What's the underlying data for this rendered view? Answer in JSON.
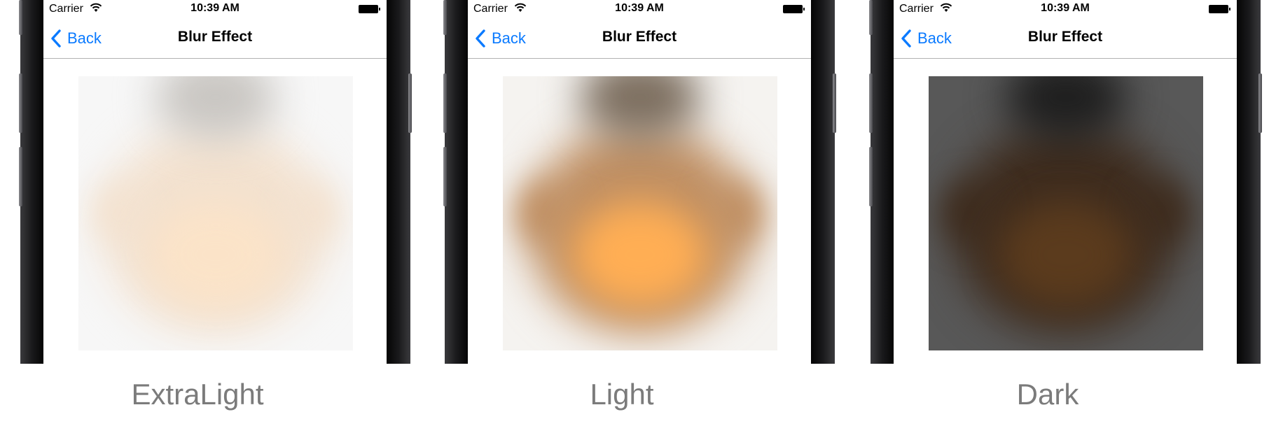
{
  "status_bar": {
    "carrier": "Carrier",
    "time": "10:39 AM"
  },
  "nav": {
    "back_label": "Back",
    "title": "Blur Effect"
  },
  "panels": [
    {
      "caption": "ExtraLight",
      "bg": "#f7f7f7",
      "top": "#c9c6c2",
      "face": "#f3e2d0",
      "center": "#fbe3c8"
    },
    {
      "caption": "Light",
      "bg": "#f5f3f0",
      "top": "#7d6f60",
      "face": "#c09064",
      "center": "#ffae54"
    },
    {
      "caption": "Dark",
      "bg": "#585858",
      "top": "#1f1f1f",
      "face": "#3e2c1e",
      "center": "#5b3b1d"
    }
  ],
  "colors": {
    "accent": "#0a7aff",
    "caption_text": "#7b7b7b"
  }
}
